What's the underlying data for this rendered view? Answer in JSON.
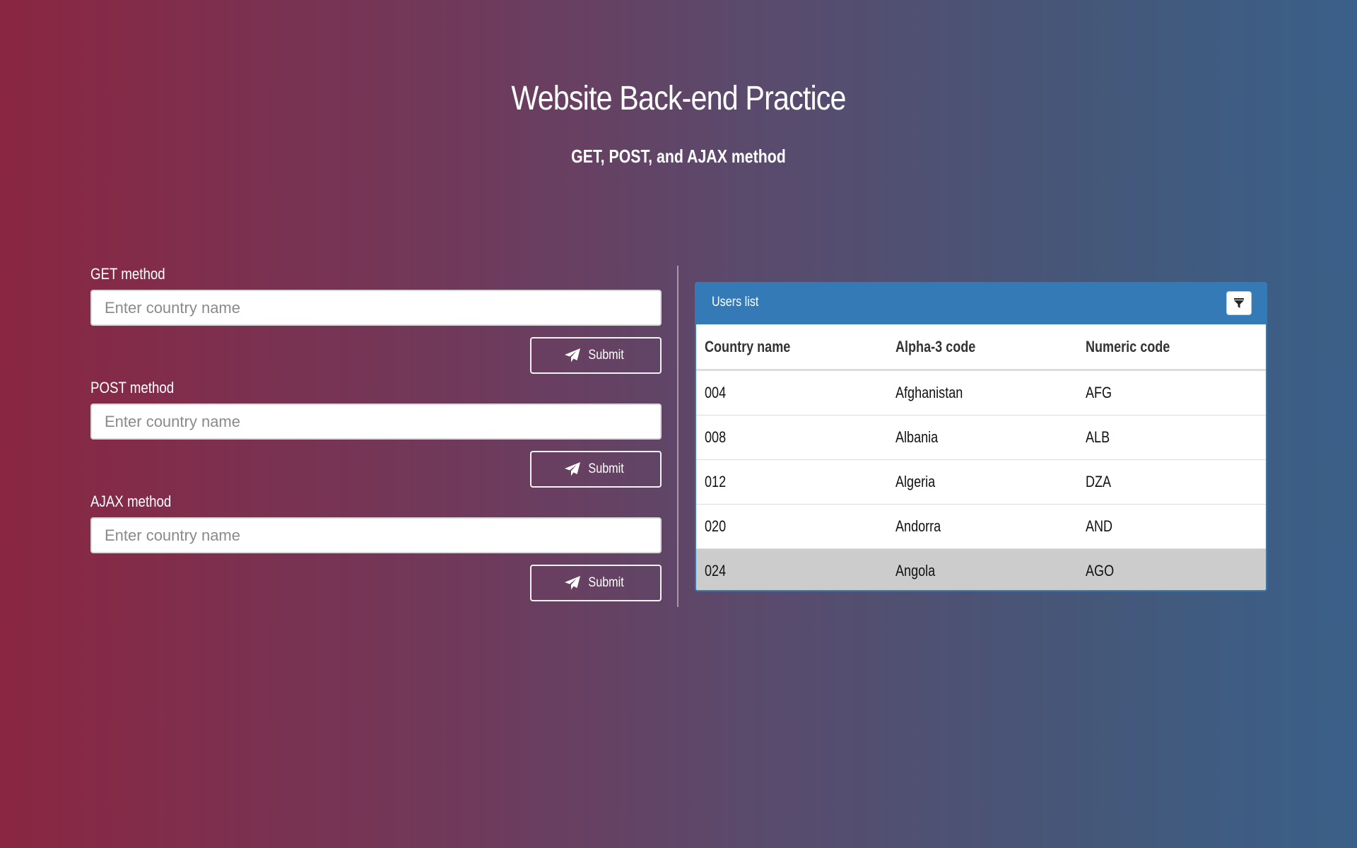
{
  "header": {
    "title": "Website Back-end Practice",
    "subtitle": "GET, POST, and AJAX method"
  },
  "forms": [
    {
      "label": "GET method",
      "placeholder": "Enter country name",
      "value": "",
      "submit_label": "Submit",
      "submit_icon": "paper-plane-icon"
    },
    {
      "label": "POST method",
      "placeholder": "Enter country name",
      "value": "",
      "submit_label": "Submit",
      "submit_icon": "paper-plane-icon"
    },
    {
      "label": "AJAX method",
      "placeholder": "Enter country name",
      "value": "",
      "submit_label": "Submit",
      "submit_icon": "paper-plane-icon"
    }
  ],
  "users_panel": {
    "title": "Users list",
    "filter_icon": "filter-icon",
    "columns": [
      "Country name",
      "Alpha-3 code",
      "Numeric code"
    ],
    "rows": [
      [
        "004",
        "Afghanistan",
        "AFG"
      ],
      [
        "008",
        "Albania",
        "ALB"
      ],
      [
        "012",
        "Algeria",
        "DZA"
      ],
      [
        "020",
        "Andorra",
        "AND"
      ],
      [
        "024",
        "Angola",
        "AGO"
      ]
    ],
    "highlighted_row": 4
  },
  "colors": {
    "gradient_left": "#8a2642",
    "gradient_right": "#3a6089",
    "panel_accent": "#337ab7",
    "row_highlight": "#cccccc"
  }
}
